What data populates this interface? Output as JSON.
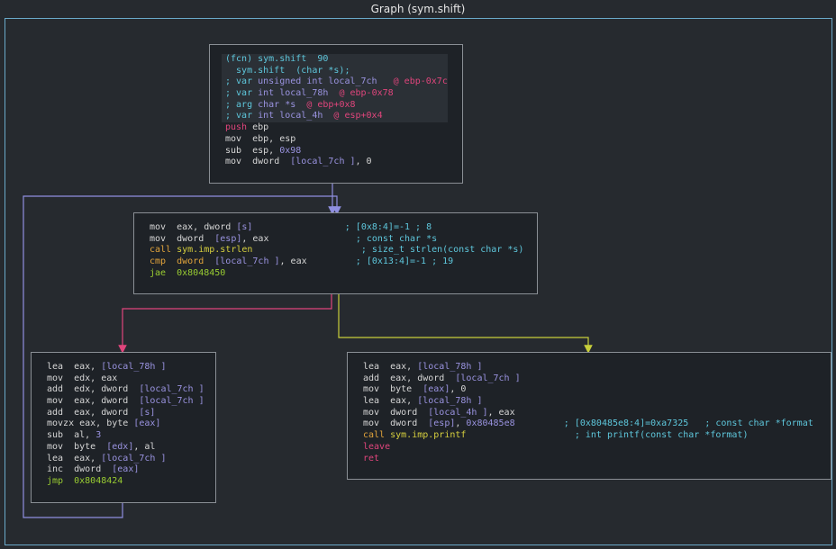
{
  "window": {
    "title": "Graph (sym.shift)"
  },
  "blocks": {
    "b1": {
      "lines": [
        [
          {
            "t": "(fcn) sym.shift  90",
            "c": "cyan"
          }
        ],
        [
          {
            "t": "  sym.shift  (char *s);",
            "c": "cyan"
          }
        ],
        [
          {
            "t": "; var ",
            "c": "cyan"
          },
          {
            "t": "unsigned int local_7ch",
            "c": "purple"
          },
          {
            "t": "   @ ebp-0x7c",
            "c": "pink"
          }
        ],
        [
          {
            "t": "; var ",
            "c": "cyan"
          },
          {
            "t": "int local_78h",
            "c": "purple"
          },
          {
            "t": "  @ ebp-0x78",
            "c": "pink"
          }
        ],
        [
          {
            "t": "; arg ",
            "c": "cyan"
          },
          {
            "t": "char *s",
            "c": "purple"
          },
          {
            "t": "  @ ebp+0x8",
            "c": "pink"
          }
        ],
        [
          {
            "t": "; var ",
            "c": "cyan"
          },
          {
            "t": "int local_4h",
            "c": "purple"
          },
          {
            "t": "  @ esp+0x4",
            "c": "pink"
          }
        ],
        [
          {
            "t": "push ",
            "c": "pink"
          },
          {
            "t": "ebp",
            "c": "white"
          }
        ],
        [
          {
            "t": "mov  ",
            "c": "white"
          },
          {
            "t": "ebp, esp",
            "c": "white"
          }
        ],
        [
          {
            "t": "sub  ",
            "c": "white"
          },
          {
            "t": "esp, ",
            "c": "white"
          },
          {
            "t": "0x98",
            "c": "purple"
          }
        ],
        [
          {
            "t": "mov  ",
            "c": "white"
          },
          {
            "t": "dword  ",
            "c": "white"
          },
          {
            "t": "[local_7ch ]",
            "c": "purple"
          },
          {
            "t": ", 0",
            "c": "white"
          }
        ]
      ]
    },
    "b2": {
      "lines": [
        [
          {
            "t": "mov  ",
            "c": "white"
          },
          {
            "t": "eax, dword ",
            "c": "white"
          },
          {
            "t": "[s]",
            "c": "purple"
          },
          {
            "t": "                 ; [0x8:4]=-1 ; 8",
            "c": "cyan"
          }
        ],
        [
          {
            "t": "mov  ",
            "c": "white"
          },
          {
            "t": "dword  ",
            "c": "white"
          },
          {
            "t": "[esp]",
            "c": "purple"
          },
          {
            "t": ", eax",
            "c": "white"
          },
          {
            "t": "                ; const char *s",
            "c": "cyan"
          }
        ],
        [
          {
            "t": "call ",
            "c": "orange"
          },
          {
            "t": "sym.imp.strlen",
            "c": "yellow"
          },
          {
            "t": "                    ; size_t strlen(const char *s)",
            "c": "cyan"
          }
        ],
        [
          {
            "t": "cmp  ",
            "c": "orange"
          },
          {
            "t": "dword  ",
            "c": "orange"
          },
          {
            "t": "[local_7ch ]",
            "c": "purple"
          },
          {
            "t": ", eax",
            "c": "white"
          },
          {
            "t": "         ; [0x13:4]=-1 ; 19",
            "c": "cyan"
          }
        ],
        [
          {
            "t": "jae  ",
            "c": "green"
          },
          {
            "t": "0x8048450",
            "c": "green"
          }
        ]
      ]
    },
    "b3": {
      "lines": [
        [
          {
            "t": "lea  ",
            "c": "white"
          },
          {
            "t": "eax, ",
            "c": "white"
          },
          {
            "t": "[local_78h ]",
            "c": "purple"
          }
        ],
        [
          {
            "t": "mov  ",
            "c": "white"
          },
          {
            "t": "edx, eax",
            "c": "white"
          }
        ],
        [
          {
            "t": "add  ",
            "c": "white"
          },
          {
            "t": "edx, dword  ",
            "c": "white"
          },
          {
            "t": "[local_7ch ]",
            "c": "purple"
          }
        ],
        [
          {
            "t": "mov  ",
            "c": "white"
          },
          {
            "t": "eax, dword  ",
            "c": "white"
          },
          {
            "t": "[local_7ch ]",
            "c": "purple"
          }
        ],
        [
          {
            "t": "add  ",
            "c": "white"
          },
          {
            "t": "eax, dword  ",
            "c": "white"
          },
          {
            "t": "[s]",
            "c": "purple"
          }
        ],
        [
          {
            "t": "movzx ",
            "c": "white"
          },
          {
            "t": "eax, byte ",
            "c": "white"
          },
          {
            "t": "[eax]",
            "c": "purple"
          }
        ],
        [
          {
            "t": "sub  ",
            "c": "white"
          },
          {
            "t": "al, ",
            "c": "white"
          },
          {
            "t": "3",
            "c": "purple"
          }
        ],
        [
          {
            "t": "mov  ",
            "c": "white"
          },
          {
            "t": "byte  ",
            "c": "white"
          },
          {
            "t": "[edx]",
            "c": "purple"
          },
          {
            "t": ", al",
            "c": "white"
          }
        ],
        [
          {
            "t": "lea  ",
            "c": "white"
          },
          {
            "t": "eax, ",
            "c": "white"
          },
          {
            "t": "[local_7ch ]",
            "c": "purple"
          }
        ],
        [
          {
            "t": "inc  ",
            "c": "white"
          },
          {
            "t": "dword  ",
            "c": "white"
          },
          {
            "t": "[eax]",
            "c": "purple"
          }
        ],
        [
          {
            "t": "jmp  ",
            "c": "green"
          },
          {
            "t": "0x8048424",
            "c": "green"
          }
        ]
      ]
    },
    "b4": {
      "lines": [
        [
          {
            "t": "lea  ",
            "c": "white"
          },
          {
            "t": "eax, ",
            "c": "white"
          },
          {
            "t": "[local_78h ]",
            "c": "purple"
          }
        ],
        [
          {
            "t": "add  ",
            "c": "white"
          },
          {
            "t": "eax, dword  ",
            "c": "white"
          },
          {
            "t": "[local_7ch ]",
            "c": "purple"
          }
        ],
        [
          {
            "t": "mov  ",
            "c": "white"
          },
          {
            "t": "byte  ",
            "c": "white"
          },
          {
            "t": "[eax]",
            "c": "purple"
          },
          {
            "t": ", 0",
            "c": "white"
          }
        ],
        [
          {
            "t": "lea  ",
            "c": "white"
          },
          {
            "t": "eax, ",
            "c": "white"
          },
          {
            "t": "[local_78h ]",
            "c": "purple"
          }
        ],
        [
          {
            "t": "mov  ",
            "c": "white"
          },
          {
            "t": "dword  ",
            "c": "white"
          },
          {
            "t": "[local_4h ]",
            "c": "purple"
          },
          {
            "t": ", eax",
            "c": "white"
          }
        ],
        [
          {
            "t": "mov  ",
            "c": "white"
          },
          {
            "t": "dword  ",
            "c": "white"
          },
          {
            "t": "[esp]",
            "c": "purple"
          },
          {
            "t": ", ",
            "c": "white"
          },
          {
            "t": "0x80485e8",
            "c": "purple"
          },
          {
            "t": "         ; [0x80485e8:4]=0xa7325   ; const char *format",
            "c": "cyan"
          }
        ],
        [
          {
            "t": "call ",
            "c": "orange"
          },
          {
            "t": "sym.imp.printf",
            "c": "yellow"
          },
          {
            "t": "                    ; int printf(const char *format)",
            "c": "cyan"
          }
        ],
        [
          {
            "t": "leave",
            "c": "pink"
          }
        ],
        [
          {
            "t": "ret",
            "c": "pink"
          }
        ]
      ]
    }
  },
  "colors": {
    "cyan": "#5ec7dc",
    "pink": "#e0457c",
    "orange": "#e0a33b",
    "yellow": "#d6cf3e",
    "green": "#9acd32",
    "purple": "#9a93e0",
    "white": "#d6d6d6",
    "edge_true": "#e0457c",
    "edge_false": "#c8cf3a",
    "edge_uncond": "#8f8fe0"
  }
}
